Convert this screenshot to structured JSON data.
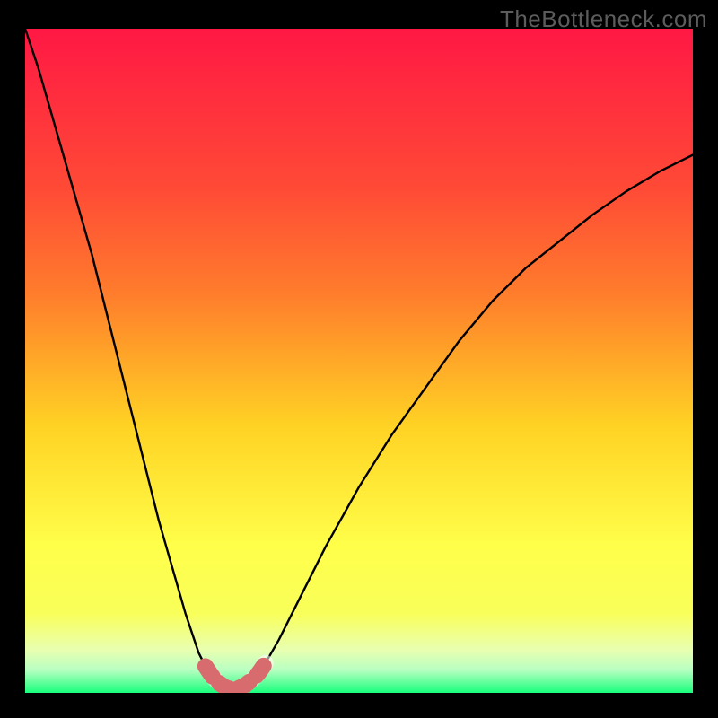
{
  "watermark": "TheBottleneck.com",
  "colors": {
    "background": "#000000",
    "gradient_top": "#ff1844",
    "gradient_upper_mid": "#ff7d2c",
    "gradient_mid": "#ffd324",
    "gradient_lower_mid": "#f9ff5a",
    "gradient_near_bottom": "#e9ffb0",
    "gradient_bottom": "#18ff7c",
    "curve": "#000000",
    "highlight": "#d86b6e"
  },
  "chart_data": {
    "type": "line",
    "title": "",
    "xlabel": "",
    "ylabel": "",
    "xlim": [
      0,
      100
    ],
    "ylim": [
      0,
      100
    ],
    "minimum_x": 31,
    "highlight_range": [
      27,
      36
    ],
    "series": [
      {
        "name": "bottleneck-curve",
        "x": [
          0,
          2,
          4,
          6,
          8,
          10,
          12,
          14,
          16,
          18,
          20,
          22,
          24,
          26,
          27,
          28,
          29,
          30,
          31,
          32,
          33,
          34,
          35,
          36,
          38,
          40,
          45,
          50,
          55,
          60,
          65,
          70,
          75,
          80,
          85,
          90,
          95,
          100
        ],
        "values": [
          100,
          94,
          87,
          80,
          73,
          66,
          58,
          50,
          42,
          34,
          26,
          19,
          12,
          6,
          4,
          2.5,
          1.5,
          0.8,
          0.5,
          0.7,
          1.2,
          2,
          3,
          4.5,
          8,
          12,
          22,
          31,
          39,
          46,
          53,
          59,
          64,
          68,
          72,
          75.5,
          78.5,
          81
        ]
      }
    ],
    "annotations": []
  }
}
